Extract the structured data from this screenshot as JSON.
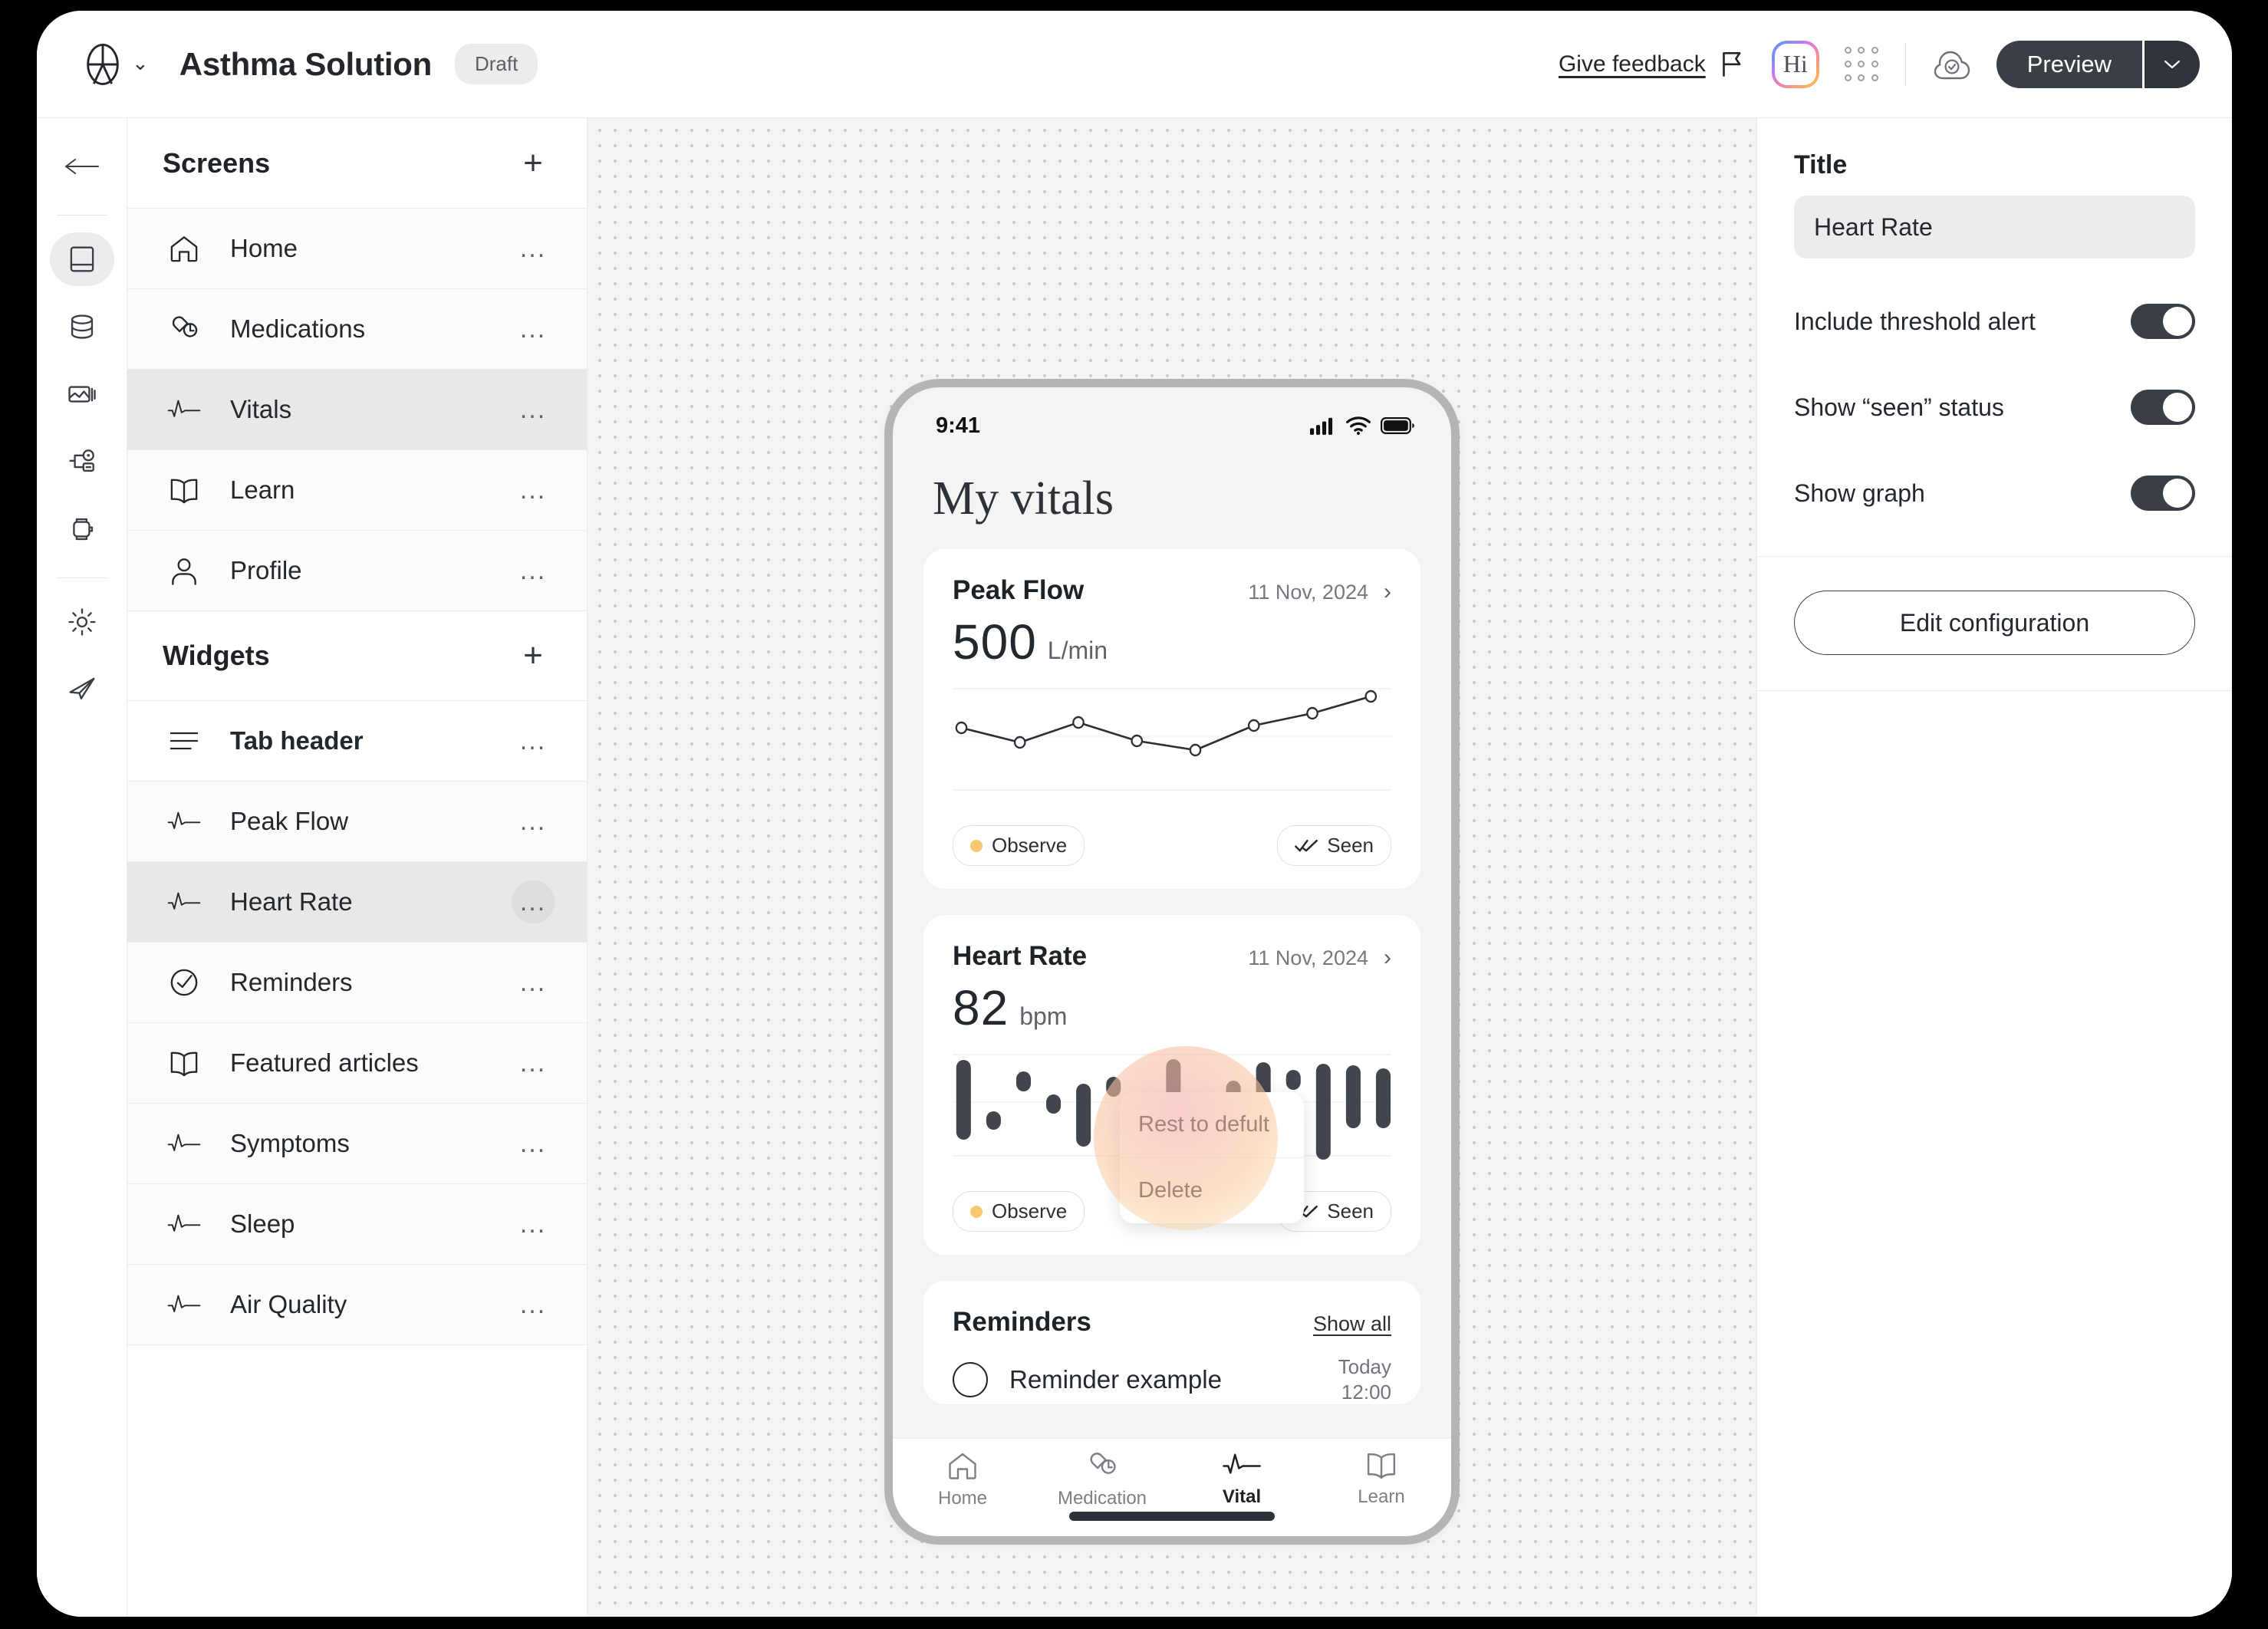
{
  "topbar": {
    "logo_icon": "accessibility-logo",
    "caret_icon": "chevron-down-icon",
    "app_title": "Asthma Solution",
    "status_badge": "Draft",
    "give_feedback": "Give feedback",
    "flag_icon": "flag-icon",
    "hi_badge": "Hi",
    "grid_icon": "apps-grid-icon",
    "cloud_icon": "cloud-saved-icon",
    "preview_label": "Preview",
    "preview_caret_icon": "chevron-down-icon"
  },
  "rail": {
    "back_icon": "arrow-left-icon",
    "items": [
      {
        "icon": "screens-icon",
        "active": true
      },
      {
        "icon": "database-icon",
        "active": false
      },
      {
        "icon": "media-icon",
        "active": false
      },
      {
        "icon": "flow-icon",
        "active": false
      },
      {
        "icon": "wearable-icon",
        "active": false
      },
      {
        "icon": "settings-gear-icon",
        "active": false
      },
      {
        "icon": "publish-rocket-icon",
        "active": false
      }
    ]
  },
  "screens_panel": {
    "title": "Screens",
    "add_label": "+",
    "items": [
      {
        "label": "Home",
        "icon": "home-icon",
        "selected": false,
        "menu": "..."
      },
      {
        "label": "Medications",
        "icon": "pills-icon",
        "selected": false,
        "menu": "..."
      },
      {
        "label": "Vitals",
        "icon": "pulse-icon",
        "selected": true,
        "menu": "..."
      },
      {
        "label": "Learn",
        "icon": "book-icon",
        "selected": false,
        "menu": "..."
      },
      {
        "label": "Profile",
        "icon": "person-icon",
        "selected": false,
        "menu": "..."
      }
    ]
  },
  "widgets_panel": {
    "title": "Widgets",
    "add_label": "+",
    "items": [
      {
        "label": "Tab header",
        "icon": "list-lines-icon",
        "selected": false,
        "bold": true,
        "menu": "..."
      },
      {
        "label": "Peak Flow",
        "icon": "pulse-icon",
        "selected": false,
        "bold": false,
        "menu": "..."
      },
      {
        "label": "Heart Rate",
        "icon": "pulse-icon",
        "selected": true,
        "bold": false,
        "menu": "..."
      },
      {
        "label": "Reminders",
        "icon": "check-circle-icon",
        "selected": false,
        "bold": false,
        "menu": "..."
      },
      {
        "label": "Featured articles",
        "icon": "book-icon",
        "selected": false,
        "bold": false,
        "menu": "..."
      },
      {
        "label": "Symptoms",
        "icon": "pulse-icon",
        "selected": false,
        "bold": false,
        "menu": "..."
      },
      {
        "label": "Sleep",
        "icon": "pulse-icon",
        "selected": false,
        "bold": false,
        "menu": "..."
      },
      {
        "label": "Air Quality",
        "icon": "pulse-icon",
        "selected": false,
        "bold": false,
        "menu": "..."
      }
    ]
  },
  "context_menu": {
    "items": [
      "Rest to defult",
      "Delete"
    ]
  },
  "phone": {
    "status_time": "9:41",
    "signal_icon": "cellular-signal-icon",
    "wifi_icon": "wifi-icon",
    "battery_icon": "battery-full-icon",
    "screen_title": "My vitals",
    "cards": [
      {
        "title": "Peak Flow",
        "date": "11 Nov, 2024",
        "chevron_icon": "chevron-right-icon",
        "value": "500",
        "unit": "L/min",
        "status_pill": "Observe",
        "seen_pill": "Seen",
        "seen_icon": "double-check-icon"
      },
      {
        "title": "Heart Rate",
        "date": "11 Nov, 2024",
        "chevron_icon": "chevron-right-icon",
        "value": "82",
        "unit": "bpm",
        "status_pill": "Observe",
        "seen_pill": "Seen",
        "seen_icon": "double-check-icon"
      }
    ],
    "reminders": {
      "title": "Reminders",
      "show_all": "Show all",
      "item_label": "Reminder example",
      "item_day": "Today",
      "item_time": "12:00"
    },
    "tabs": [
      {
        "label": "Home",
        "icon": "home-icon",
        "active": false
      },
      {
        "label": "Medication",
        "icon": "pills-icon",
        "active": false
      },
      {
        "label": "Vital",
        "icon": "pulse-icon",
        "active": true
      },
      {
        "label": "Learn",
        "icon": "book-icon",
        "active": false
      }
    ]
  },
  "right_panel": {
    "title_label": "Title",
    "title_value": "Heart Rate",
    "title_placeholder": "Title",
    "toggles": [
      {
        "label": "Include threshold alert",
        "on": true
      },
      {
        "label": "Show “seen” status",
        "on": true
      },
      {
        "label": "Show graph",
        "on": true
      }
    ],
    "edit_config_label": "Edit configuration"
  },
  "chart_data": [
    {
      "type": "line",
      "title": "Peak Flow",
      "ylabel": "L/min",
      "x": [
        1,
        2,
        3,
        4,
        5,
        6,
        7,
        8
      ],
      "values": [
        500,
        470,
        510,
        472,
        455,
        500,
        528,
        560
      ],
      "ylim": [
        420,
        580
      ],
      "grid": true,
      "marker": "open-circle"
    },
    {
      "type": "bar",
      "title": "Heart Rate",
      "ylabel": "bpm",
      "note": "floating range (candlestick style) bars: each bar spans a low-high value",
      "categories": [
        1,
        2,
        3,
        4,
        5,
        6,
        7,
        8,
        9,
        10,
        11,
        12,
        13,
        14,
        15
      ],
      "series": [
        {
          "name": "low",
          "values": [
            64,
            72,
            86,
            78,
            62,
            86,
            76,
            70,
            64,
            76,
            56,
            88,
            60,
            50,
            70
          ]
        },
        {
          "name": "high",
          "values": [
            96,
            78,
            94,
            84,
            88,
            92,
            82,
            96,
            78,
            90,
            94,
            94,
            90,
            92,
            94
          ]
        }
      ],
      "ylim": [
        46,
        100
      ],
      "grid": true
    }
  ]
}
